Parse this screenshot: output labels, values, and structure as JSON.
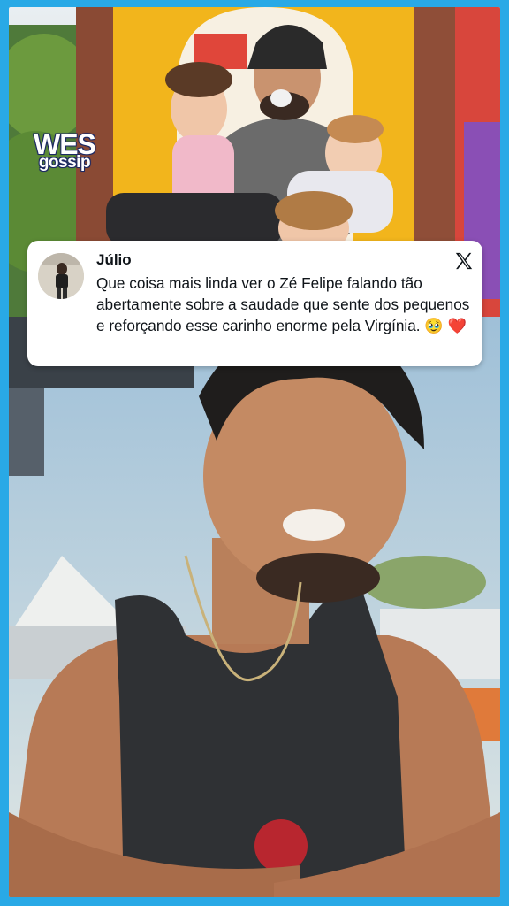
{
  "brand": {
    "logo_line1": "WES",
    "logo_line2": "gossip"
  },
  "tweet": {
    "author_name": "Júlio",
    "text": "Que coisa mais linda ver o Zé Felipe falando tão abertamente sobre a saudade que sente dos pequenos e reforçando esse carinho enorme pela Virgínia. 🥹 ❤️"
  },
  "icons": {
    "platform": "x-logo-icon"
  },
  "colors": {
    "frame_border": "#29a9e6",
    "card_background": "#ffffff",
    "text": "#0f1419"
  }
}
